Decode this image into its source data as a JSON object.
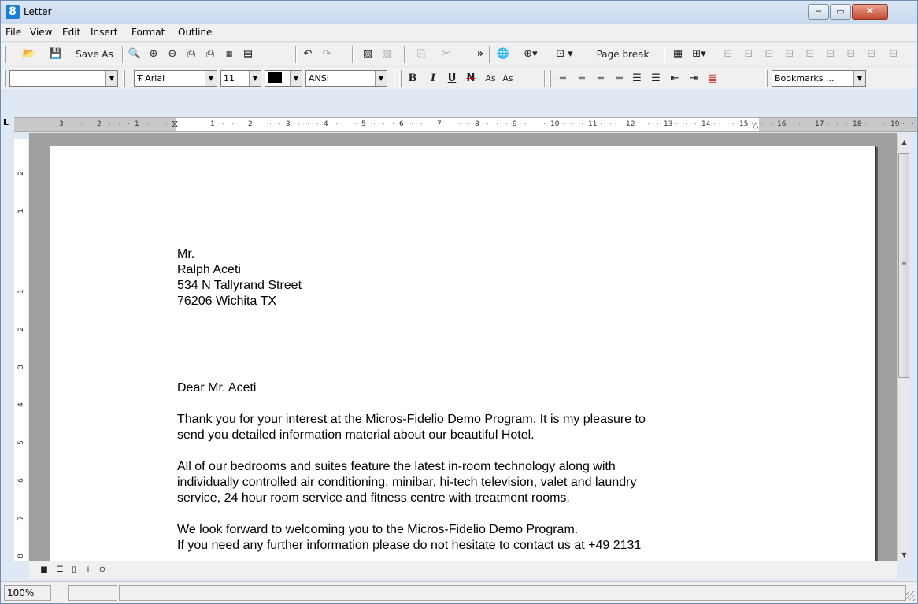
{
  "window": {
    "title": "Letter",
    "app_icon_glyph": "8",
    "controls": {
      "minimize": "─",
      "maximize": "▭",
      "close": "✕"
    }
  },
  "menu": {
    "items": [
      "File",
      "View",
      "Edit",
      "Insert",
      "Format",
      "Outline"
    ]
  },
  "toolbar1": {
    "save_as_label": "Save As",
    "page_break_label": "Page break",
    "overflow": "»"
  },
  "toolbar2": {
    "style_value": "",
    "font_value": "Arial",
    "font_icon": "Ŧ",
    "size_value": "11",
    "charset_value": "ANSI",
    "bookmarks_value": "Bookmarks ...",
    "bold": "B",
    "italic": "I",
    "underline": "U",
    "strike": "N",
    "subscript": "As",
    "superscript": "As"
  },
  "ruler": {
    "numbers": [
      "3",
      "2",
      "1",
      "1",
      "2",
      "3",
      "4",
      "5",
      "6",
      "7",
      "8",
      "9",
      "10",
      "11",
      "12",
      "13",
      "14",
      "15",
      "16",
      "17",
      "18",
      "19"
    ],
    "vertical_numbers": [
      "2",
      "1",
      "1",
      "2",
      "3",
      "4",
      "5",
      "6",
      "7",
      "8"
    ]
  },
  "letter": {
    "address": [
      "Mr.",
      "Ralph Aceti",
      "534 N Tallyrand Street",
      "76206 Wichita TX"
    ],
    "salutation": "Dear Mr. Aceti",
    "paragraph1": [
      "Thank you for your interest at the Micros-Fidelio Demo Program.  It is my pleasure to",
      "send you detailed information material about our beautiful Hotel."
    ],
    "paragraph2": [
      "All of our bedrooms and suites feature the latest in-room technology along with",
      "individually controlled air conditioning, minibar, hi-tech television, valet and laundry",
      "service, 24 hour room service and fitness centre with treatment rooms."
    ],
    "paragraph3": [
      "We look forward to welcoming you to the Micros-Fidelio Demo Program.",
      "If you need any further information please do not hesitate to contact us at +49 2131"
    ]
  },
  "status": {
    "zoom": "100%",
    "cell2": "",
    "cell3": ""
  }
}
